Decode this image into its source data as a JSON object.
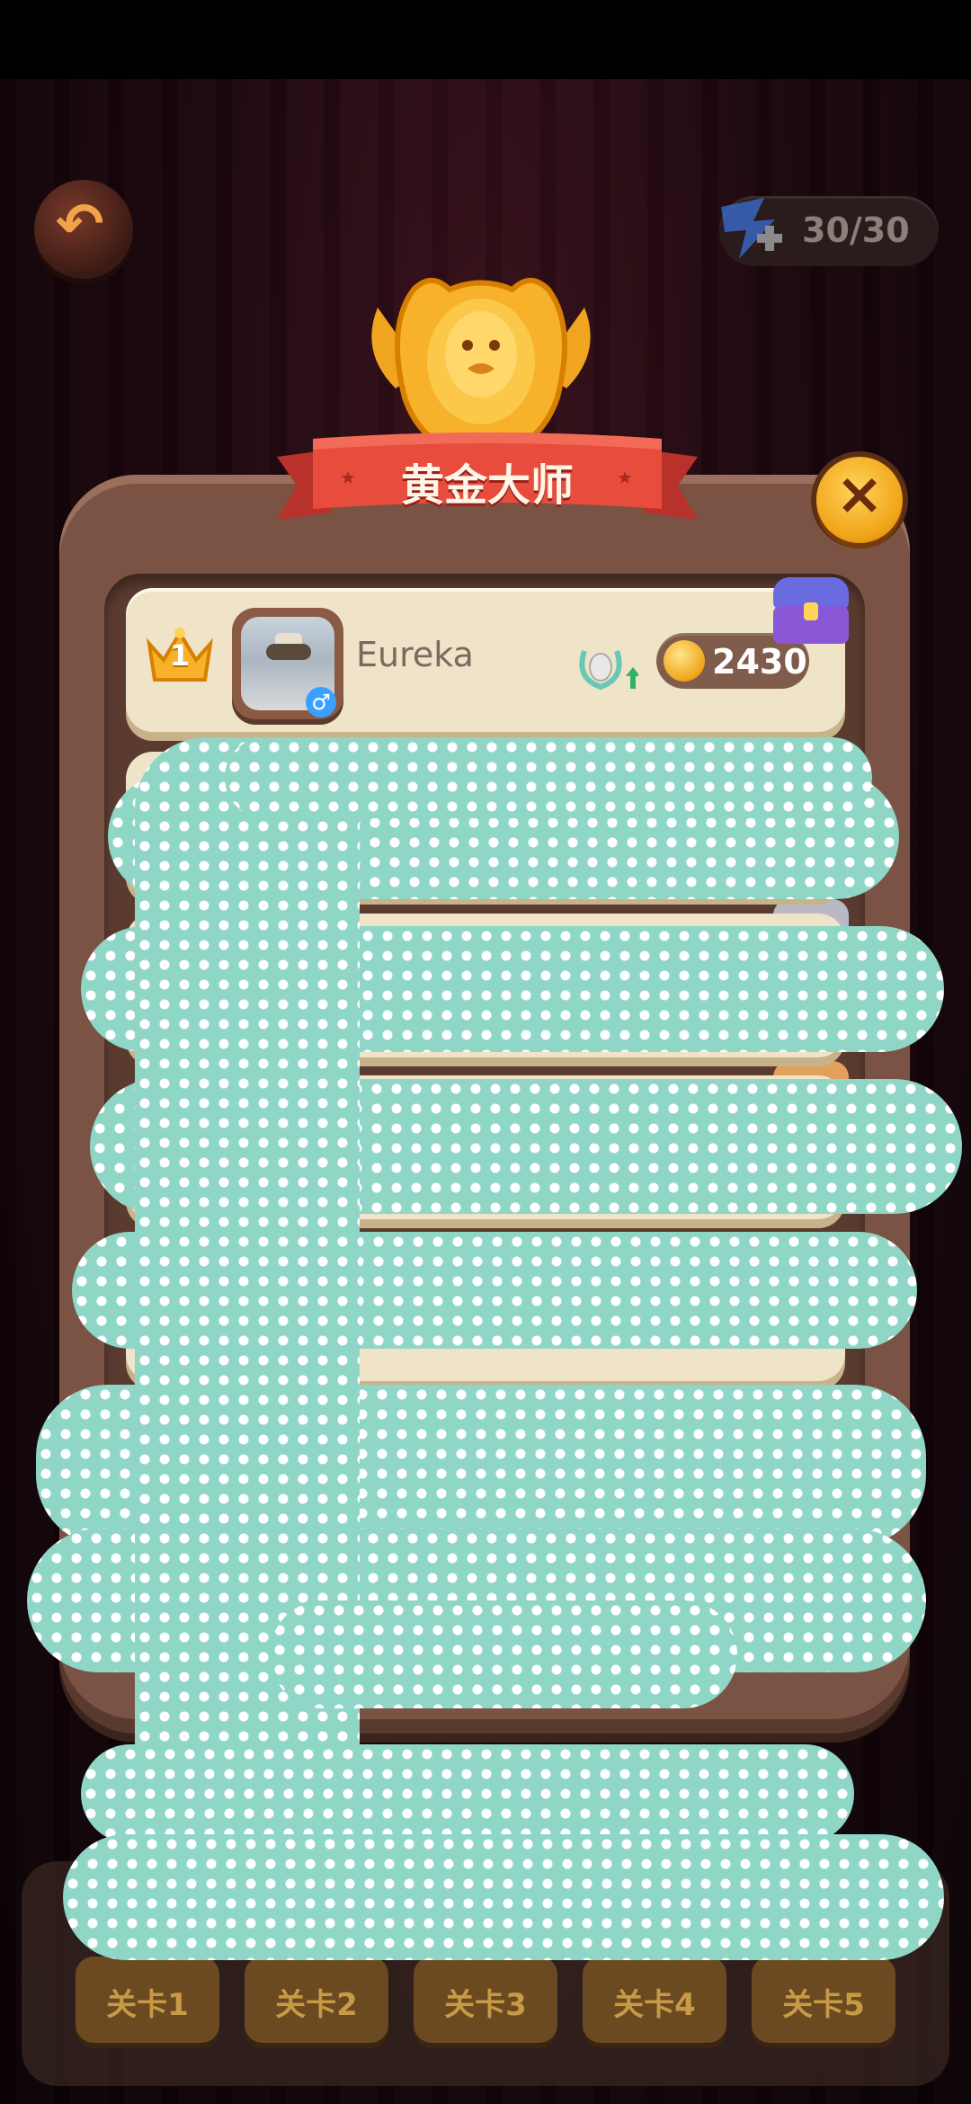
{
  "status_bar": {},
  "header": {
    "energy_value": "30/30"
  },
  "dialog": {
    "title": "黄金大师",
    "close_icon": "close-icon",
    "rows": [
      {
        "rank": "1",
        "name": "Eureka",
        "gender": "♂",
        "score": "2430"
      }
    ]
  },
  "levels": [
    {
      "label": "关卡1"
    },
    {
      "label": "关卡2"
    },
    {
      "label": "关卡3"
    },
    {
      "label": "关卡4"
    },
    {
      "label": "关卡5"
    }
  ],
  "colors": {
    "ribbon": "#e84c3d",
    "panel": "#7b5344",
    "row": "#efe3c8",
    "close": "#f2a51a",
    "redaction": "#8fd6c7"
  }
}
